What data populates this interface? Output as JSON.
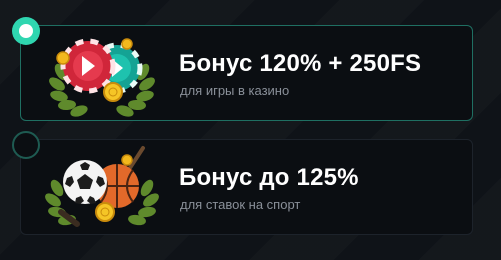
{
  "colors": {
    "accent": "#2fd6b0",
    "card_background": "#0b0e12",
    "page_background": "#0f1318",
    "title": "#ffffff",
    "subtitle": "#8a9099"
  },
  "bonus_options": [
    {
      "id": "casino",
      "title": "Бонус 120% + 250FS",
      "subtitle": "для игры в казино",
      "selected": true,
      "icon": "casino-chips-icon"
    },
    {
      "id": "sport",
      "title": "Бонус до 125%",
      "subtitle": "для ставок на спорт",
      "selected": false,
      "icon": "sport-balls-icon"
    }
  ]
}
